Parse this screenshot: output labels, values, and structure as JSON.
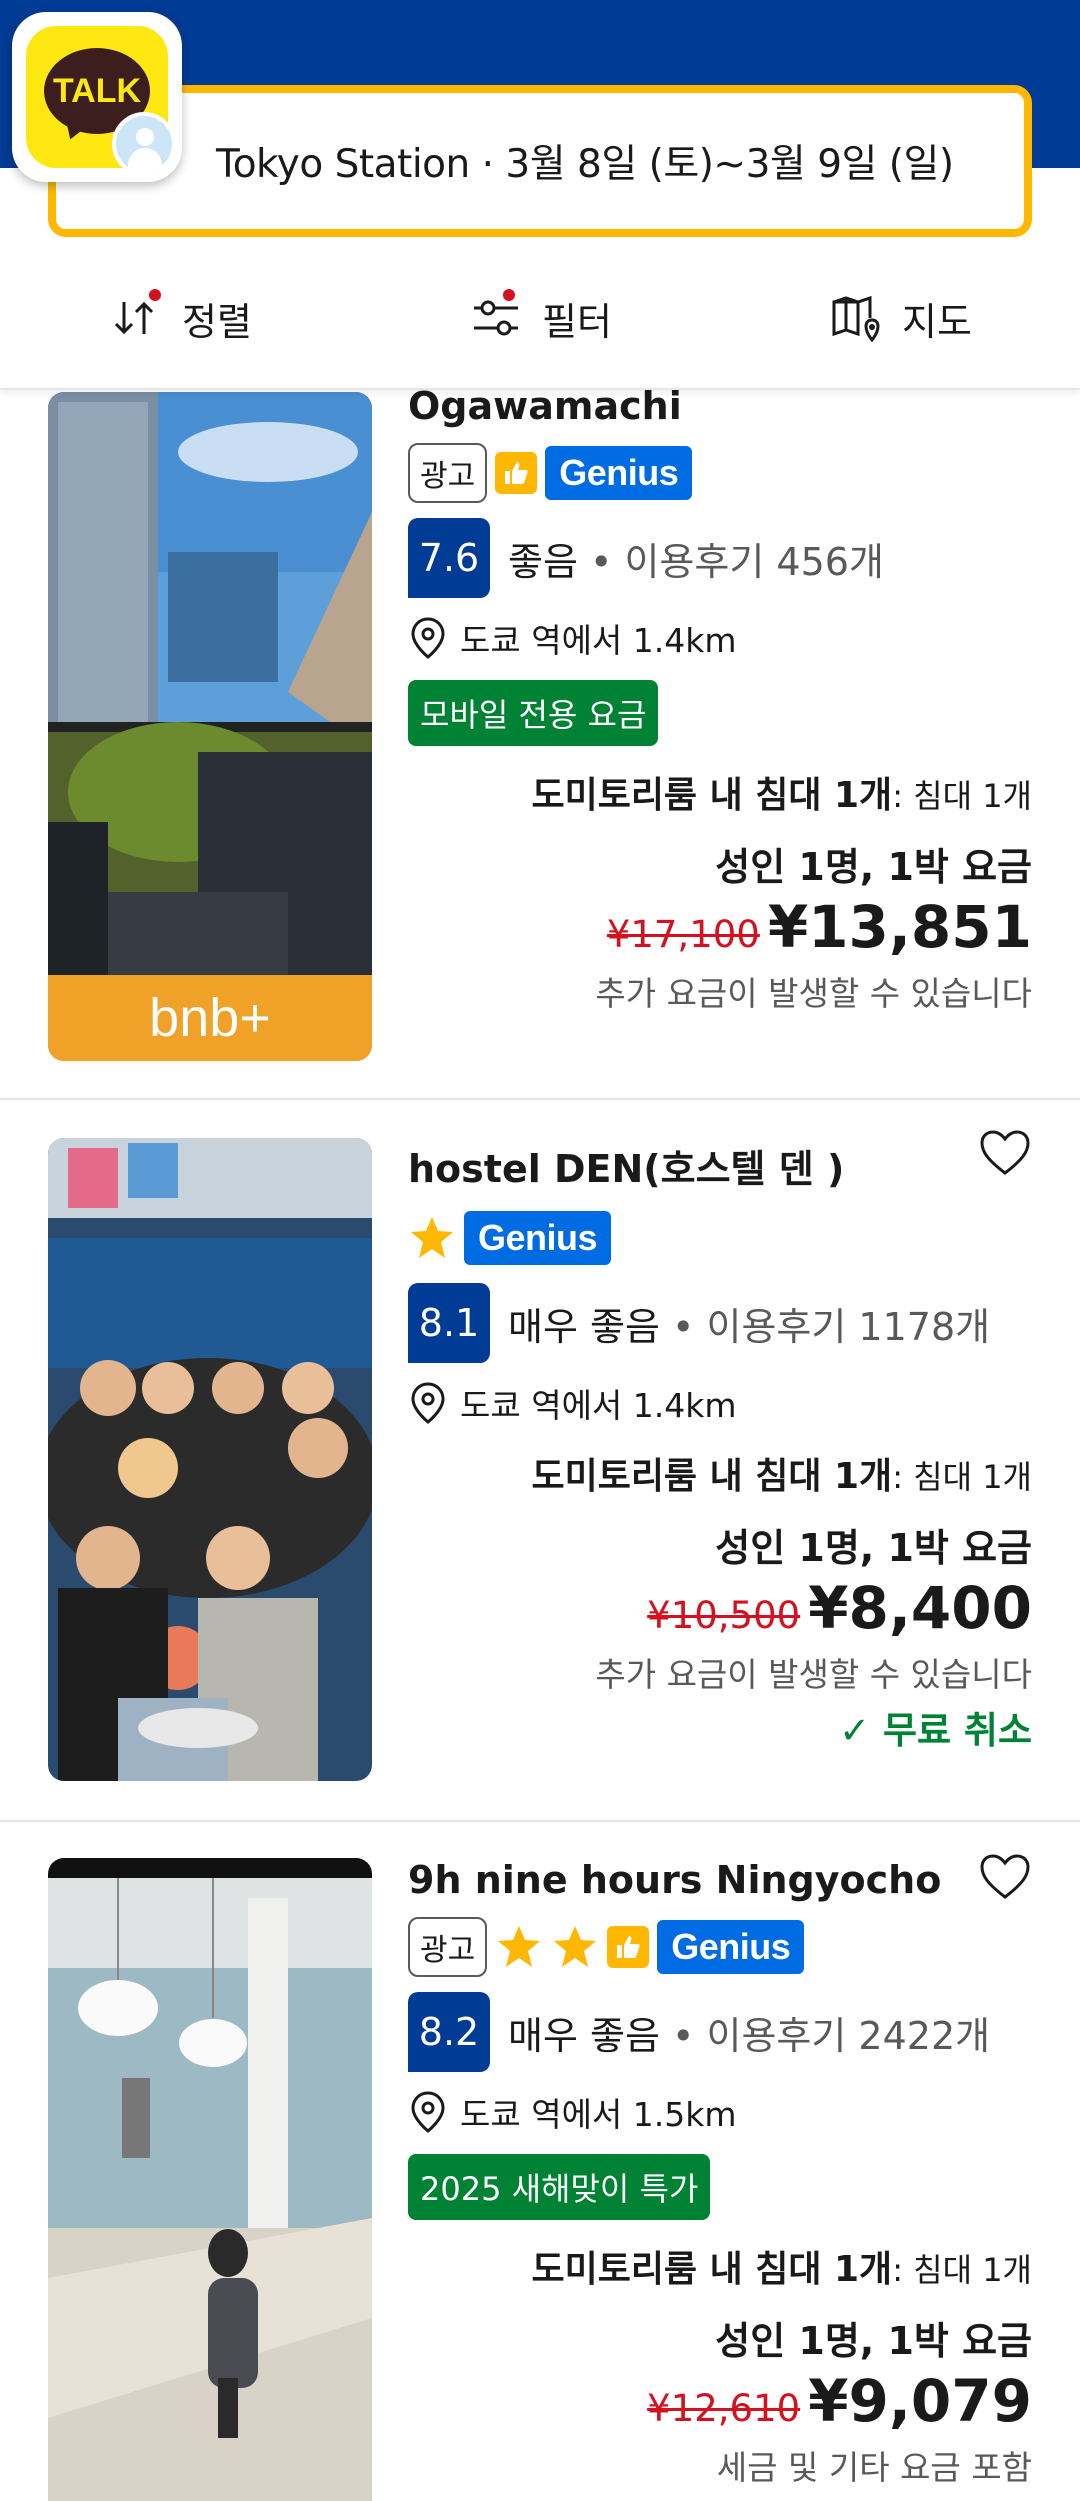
{
  "search": {
    "query": "Tokyo Station · 3월 8일 (토)~3월 9일 (일)"
  },
  "talk": {
    "label": "TALK"
  },
  "actions": {
    "sort": "정렬",
    "filter": "필터",
    "map": "지도"
  },
  "listings": [
    {
      "name": "Ogawamachi",
      "ad_label": "광고",
      "genius": "Genius",
      "score": "7.6",
      "rating_word": "좋음",
      "reviews": "이용후기 456개",
      "distance": "도쿄 역에서 1.4km",
      "promo": "모바일 전용 요금",
      "room": "도미토리룸 내 침대 1개",
      "room_detail": ": 침대 1개",
      "per": "성인 1명, 1박 요금",
      "old_price": "¥17,100",
      "new_price": "¥13,851",
      "extra": "추가 요금이 발생할 수 있습니다",
      "photo_badge": "bnb+"
    },
    {
      "name": "hostel DEN(호스텔 덴 )",
      "genius": "Genius",
      "score": "8.1",
      "rating_word": "매우 좋음",
      "reviews": "이용후기 1178개",
      "distance": "도쿄 역에서 1.4km",
      "room": "도미토리룸 내 침대 1개",
      "room_detail": ": 침대 1개",
      "per": "성인 1명, 1박 요금",
      "old_price": "¥10,500",
      "new_price": "¥8,400",
      "extra": "추가 요금이 발생할 수 있습니다",
      "free_cancel": "✓ 무료 취소"
    },
    {
      "name": "9h nine hours Ningyocho",
      "ad_label": "광고",
      "genius": "Genius",
      "score": "8.2",
      "rating_word": "매우 좋음",
      "reviews": "이용후기 2422개",
      "distance": "도쿄 역에서 1.5km",
      "promo": "2025 새해맞이 특가",
      "room": "도미토리룸 내 침대 1개",
      "room_detail": ": 침대 1개",
      "per": "성인 1명, 1박 요금",
      "old_price": "¥12,610",
      "new_price": "¥9,079",
      "extra": "세금 및 기타 요금 포함"
    }
  ],
  "colors": {
    "brand": "#003b95",
    "accent": "#ffb700",
    "genius": "#006ce4",
    "green": "#008234",
    "red": "#d4111e"
  }
}
